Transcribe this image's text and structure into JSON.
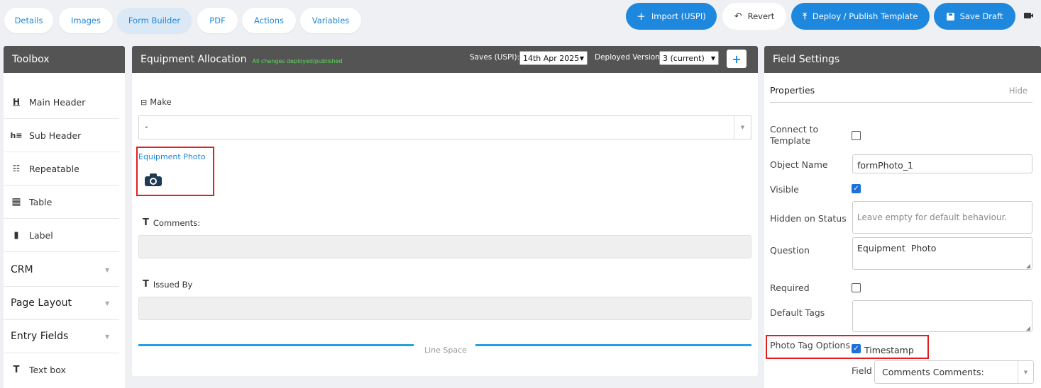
{
  "tabs": [
    {
      "label": "Details",
      "active": false
    },
    {
      "label": "Images",
      "active": false
    },
    {
      "label": "Form Builder",
      "active": true
    },
    {
      "label": "PDF",
      "active": false
    },
    {
      "label": "Actions",
      "active": false
    },
    {
      "label": "Variables",
      "active": false
    }
  ],
  "toolbar": {
    "import_label": "Import (USPI)",
    "revert_label": "Revert",
    "deploy_label": "Deploy / Publish Template",
    "save_label": "Save Draft"
  },
  "toolbox": {
    "title": "Toolbox",
    "items": [
      {
        "label": "Main Header",
        "icon": "main-header-icon"
      },
      {
        "label": "Sub Header",
        "icon": "sub-header-icon"
      },
      {
        "label": "Repeatable",
        "icon": "repeatable-icon"
      },
      {
        "label": "Table",
        "icon": "table-icon"
      },
      {
        "label": "Label",
        "icon": "label-icon"
      }
    ],
    "categories": [
      {
        "label": "CRM"
      },
      {
        "label": "Page Layout"
      },
      {
        "label": "Entry Fields"
      }
    ],
    "entry_items": [
      {
        "label": "Text box",
        "icon": "text-icon"
      }
    ]
  },
  "form": {
    "title": "Equipment Allocation",
    "status": "All changes deployed/published",
    "saves_label": "Saves (USPI):",
    "saves_value": "14th Apr 2025",
    "deployed_label": "Deployed Version:",
    "deployed_value": "3 (current)",
    "add_label": "+",
    "make_label": "Make",
    "make_value": "-",
    "photo_label": "Equipment Photo",
    "comments_label": "Comments:",
    "issued_label": "Issued By",
    "line_space_label": "Line Space"
  },
  "settings": {
    "title": "Field Settings",
    "properties_label": "Properties",
    "hide_label": "Hide",
    "connect_label": "Connect to Template",
    "connect_checked": false,
    "object_name_label": "Object Name",
    "object_name_value": "formPhoto_1",
    "visible_label": "Visible",
    "visible_checked": true,
    "hidden_status_label": "Hidden on Status",
    "hidden_status_placeholder": "Leave empty for default behaviour.",
    "question_label": "Question",
    "question_value": "Equipment  Photo",
    "required_label": "Required",
    "required_checked": false,
    "default_tags_label": "Default Tags",
    "photo_tag_label": "Photo Tag Options",
    "timestamp_label": "Timestamp",
    "timestamp_checked": true,
    "field_label": "Field",
    "field_value": "Comments Comments:"
  },
  "colors": {
    "accent": "#1e88df",
    "header": "#545454",
    "highlight": "#e02020",
    "status_green": "#5cdc5c"
  }
}
